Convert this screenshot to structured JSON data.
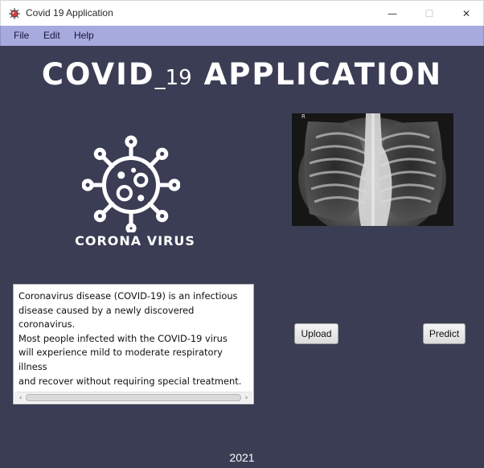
{
  "window": {
    "title": "Covid 19 Application",
    "controls": {
      "minimize": "—",
      "maximize": "☐",
      "close": "✕"
    }
  },
  "menubar": {
    "items": [
      {
        "label": "File"
      },
      {
        "label": "Edit"
      },
      {
        "label": "Help"
      }
    ]
  },
  "header": {
    "title_main": "COVID",
    "title_sub": "_19",
    "title_rest": " APPLICATION"
  },
  "logo": {
    "caption": "CORONA VIRUS",
    "icon": "virus-icon"
  },
  "xray": {
    "corner_mark": "R"
  },
  "info_box": {
    "lines": [
      "Coronavirus disease (COVID-19) is an infectious",
      "disease caused by a newly discovered coronavirus.",
      "Most people infected with the COVID-19 virus",
      "will experience mild to moderate respiratory illness",
      "and recover without requiring special treatment."
    ]
  },
  "buttons": {
    "upload": "Upload",
    "predict": "Predict"
  },
  "footer": {
    "year": "2021"
  },
  "colors": {
    "background": "#3a3d54",
    "menubar": "#a7aadd",
    "text_light": "#ffffff"
  }
}
